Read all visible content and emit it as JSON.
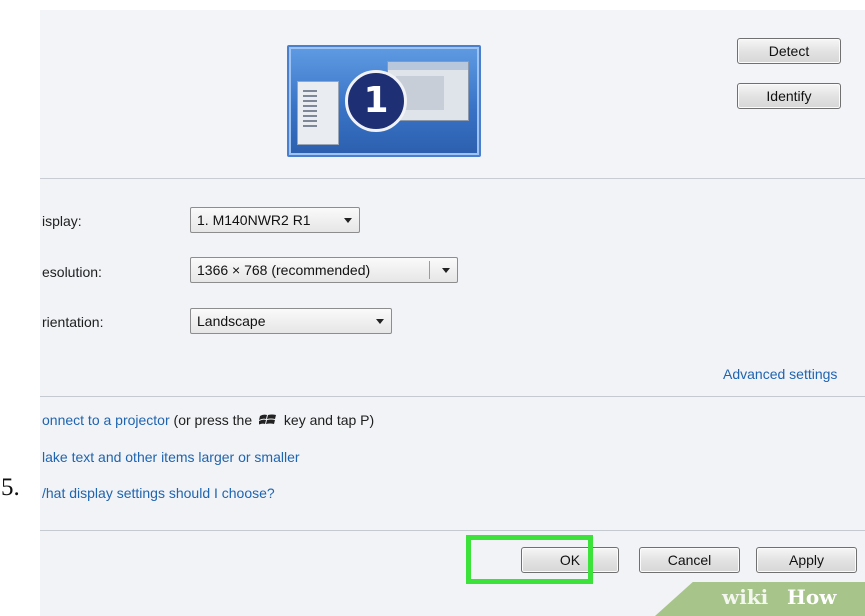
{
  "step_number": "5.",
  "monitor": {
    "badge": "1"
  },
  "buttons": {
    "detect": "Detect",
    "identify": "Identify",
    "ok": "OK",
    "cancel": "Cancel",
    "apply": "Apply"
  },
  "fields": {
    "display": {
      "label": "isplay:",
      "value": "1. M140NWR2 R1"
    },
    "resolution": {
      "label": "esolution:",
      "value": "1366 × 768 (recommended)"
    },
    "orientation": {
      "label": "rientation:",
      "value": "Landscape"
    }
  },
  "links": {
    "advanced": "Advanced settings",
    "projector_link": "onnect to a projector",
    "projector_pre": "(or press the",
    "projector_post": "key and tap P)",
    "text_size": "lake text and other items larger or smaller",
    "what_settings": "/hat display settings should I choose?"
  },
  "watermark": {
    "wiki": "wiki",
    "how": "How"
  },
  "colors": {
    "highlight": "#3ce23a",
    "link": "#1f64b0",
    "monitor_blue": "#3a74c7"
  },
  "icons": [
    "windows-logo-icon",
    "dropdown-arrow-icon"
  ]
}
